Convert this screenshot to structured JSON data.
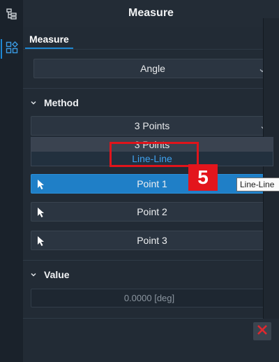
{
  "panel": {
    "title": "Measure",
    "tab_label": "Measure",
    "measure_type": "Angle"
  },
  "method": {
    "header": "Method",
    "selected": "3 Points",
    "options": [
      "3 Points",
      "Line-Line"
    ]
  },
  "points": [
    {
      "label": "Point 1",
      "selected": true
    },
    {
      "label": "Point 2",
      "selected": false
    },
    {
      "label": "Point 3",
      "selected": false
    }
  ],
  "value": {
    "header": "Value",
    "readout": "0.0000 [deg]"
  },
  "annotation": {
    "step_number": "5",
    "tooltip": "Line-Line"
  },
  "colors": {
    "accent": "#1e88d4",
    "option_highlight": "#3fa2f0",
    "callout_red": "#e0141b",
    "close_icon": "#e0282e"
  },
  "icons": {
    "leftbar": [
      "tree-icon",
      "shapes-icon"
    ],
    "dropdown": "chevron-down-icon",
    "section": "chevron-down-icon",
    "point": "cursor-arrow-icon",
    "close": "close-icon"
  }
}
